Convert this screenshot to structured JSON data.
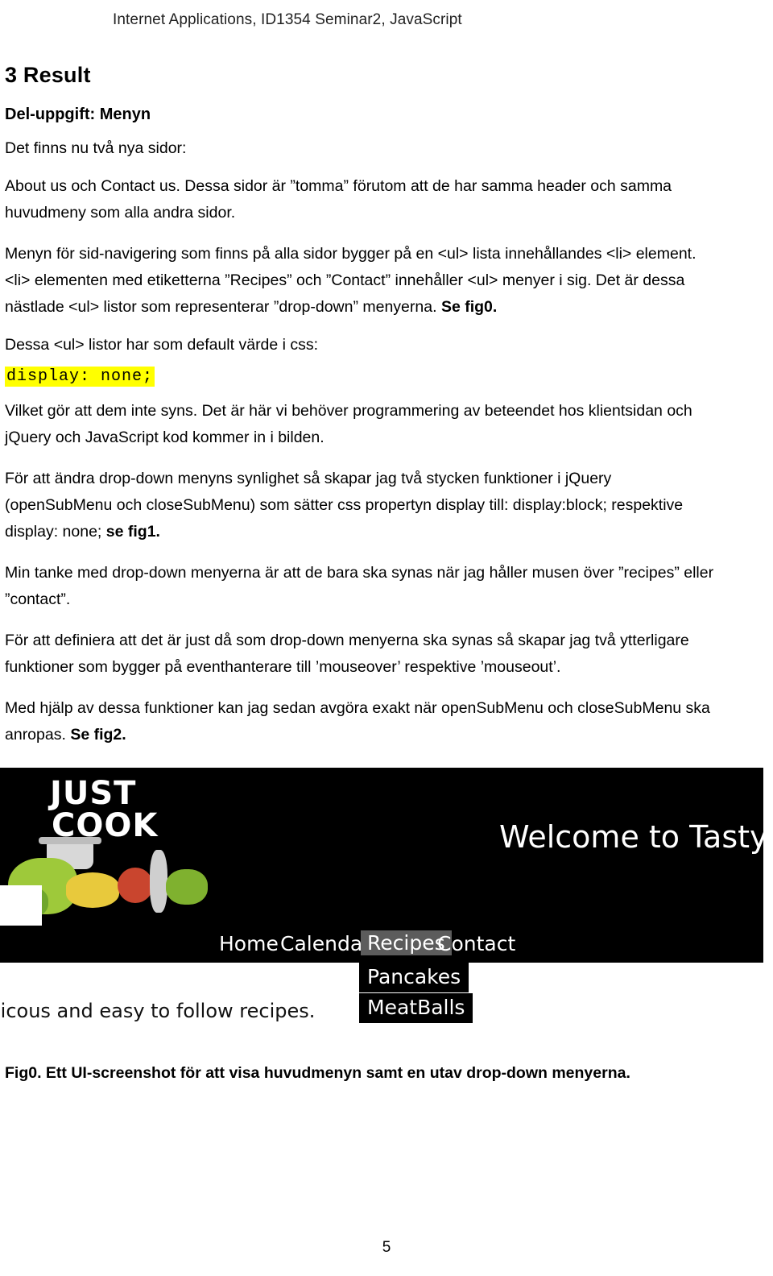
{
  "header": {
    "running_head": "Internet Applications, ID1354 Seminar2, JavaScript"
  },
  "document": {
    "heading1": "3 Result",
    "heading2": "Del-uppgift: Menyn",
    "paragraphs": {
      "p1": "Det finns nu två nya sidor:",
      "p2": "About us och Contact us. Dessa sidor är ”tomma” förutom att de har samma header och samma huvudmeny som alla andra sidor.",
      "p3_a": "Menyn för sid-navigering som finns på alla sidor bygger på en <ul> lista innehållandes <li> element. <li> elementen med etiketterna ”Recipes” och ”Contact” innehåller <ul> menyer i sig. Det är dessa nästlade <ul> listor som representerar ”drop-down” menyerna. ",
      "p3_b": "Se fig0.",
      "p4": "Dessa <ul> listor har som default värde i css:",
      "code": "display: none;",
      "p5": "Vilket gör att dem inte syns. Det är här vi behöver programmering av beteendet hos klientsidan och jQuery och JavaScript kod kommer in i bilden.",
      "p6_a": "För att ändra drop-down menyns synlighet så skapar jag två stycken funktioner i jQuery (openSubMenu och closeSubMenu) som sätter css propertyn display till: display:block; respektive display: none;  ",
      "p6_b": "se fig1.",
      "p7": "Min tanke med drop-down menyerna är att de bara ska synas när jag håller musen över ”recipes” eller ”contact”.",
      "p8": "För att definiera att det är just då som drop-down menyerna ska synas så skapar jag två ytterligare funktioner som bygger på eventhanterare till ’mouseover’ respektive ’mouseout’.",
      "p9_a": "Med hjälp av dessa funktioner kan jag sedan avgöra exakt när openSubMenu och closeSubMenu ska anropas. ",
      "p9_b": "Se fig2."
    },
    "figure": {
      "logo_line1": "JUST",
      "logo_line2": "COOK",
      "welcome_text": "Welcome to TastyR",
      "nav": [
        {
          "label": "Home",
          "active": false
        },
        {
          "label": "Calendar",
          "active": false
        },
        {
          "label": "Recipes",
          "active": true
        },
        {
          "label": "Contact",
          "active": false
        }
      ],
      "submenu": [
        {
          "label": "Pancakes"
        },
        {
          "label": "MeatBalls"
        }
      ],
      "tagline": "licous and easy to follow recipes.",
      "caption": "Fig0. Ett UI-screenshot för att visa huvudmenyn samt en utav drop-down menyerna."
    },
    "page_number": "5"
  }
}
